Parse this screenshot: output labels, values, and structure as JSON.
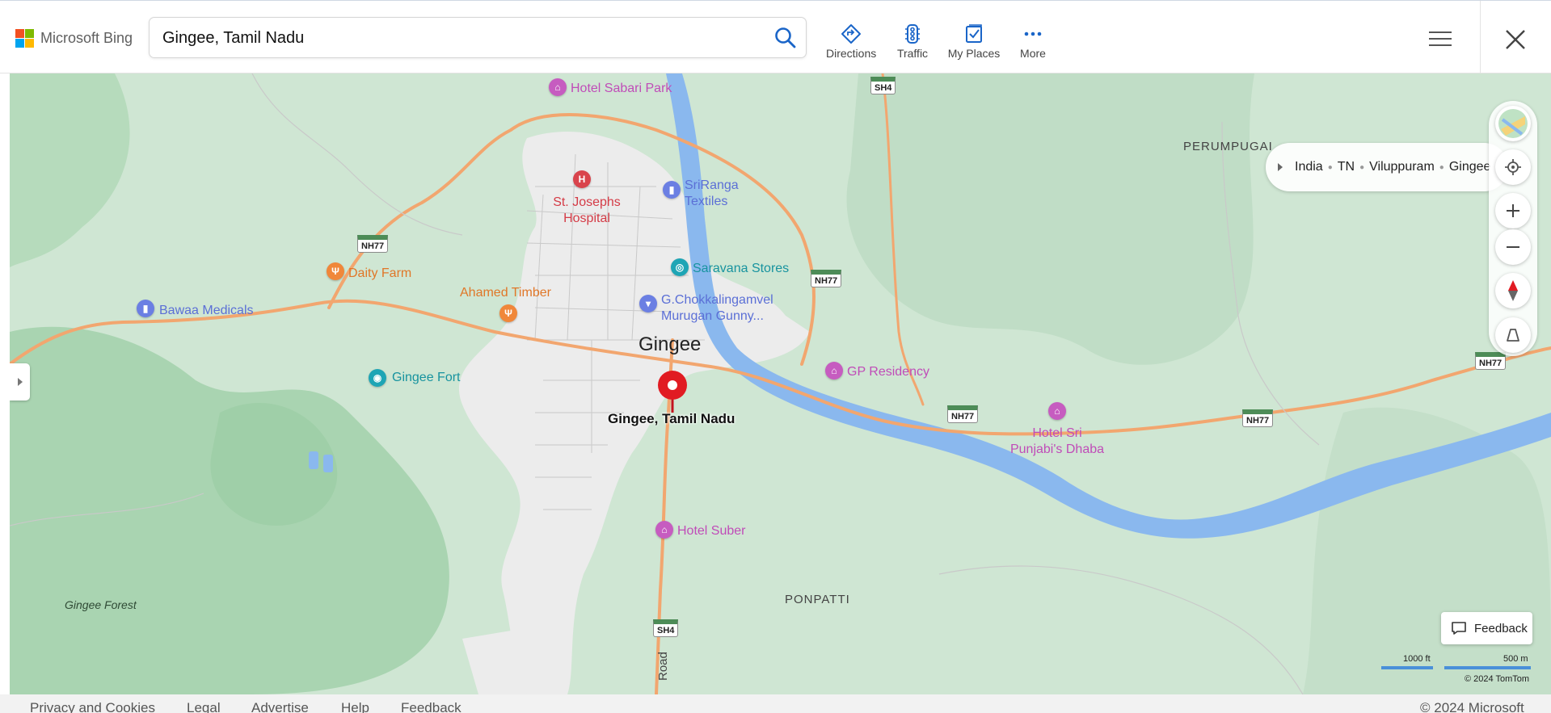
{
  "brand": {
    "name": "Microsoft Bing",
    "logo_colors": [
      "#f25022",
      "#7fba00",
      "#00a4ef",
      "#ffb900"
    ]
  },
  "search": {
    "value": "Gingee, Tamil Nadu",
    "icon": "search-icon"
  },
  "toolbar": [
    {
      "label": "Directions",
      "icon": "directions-icon"
    },
    {
      "label": "Traffic",
      "icon": "traffic-icon"
    },
    {
      "label": "My Places",
      "icon": "my-places-icon"
    },
    {
      "label": "More",
      "icon": "more-icon"
    }
  ],
  "breadcrumb": [
    "India",
    "TN",
    "Viluppuram",
    "Gingee"
  ],
  "map": {
    "pin_label": "Gingee, Tamil Nadu",
    "town_label": "Gingee",
    "place_labels": {
      "perumpugai": "PERUMPUGAI",
      "ponpatti": "PONPATTI",
      "forest": "Gingee Forest",
      "road": "Road"
    },
    "pois": [
      {
        "label": "Hotel Sabari Park",
        "icon": "hotel-icon"
      },
      {
        "label": "St. Josephs Hospital",
        "icon": "hospital-icon"
      },
      {
        "label": "SriRanga Textiles",
        "icon": "shopping-icon"
      },
      {
        "label": "Saravana Stores",
        "icon": "store-icon"
      },
      {
        "label": "Daity Farm",
        "icon": "restaurant-icon"
      },
      {
        "label": "Ahamed Timber",
        "icon": "restaurant-icon"
      },
      {
        "label": "G.Chokkalingamvel Murugan Gunny...",
        "icon": "cart-icon"
      },
      {
        "label": "Bawaa Medicals",
        "icon": "pharmacy-icon"
      },
      {
        "label": "Gingee Fort",
        "icon": "camera-icon"
      },
      {
        "label": "GP Residency",
        "icon": "hotel-icon"
      },
      {
        "label": "Hotel Sri Punjabi's Dhaba",
        "icon": "hotel-icon"
      },
      {
        "label": "Hotel Suber",
        "icon": "hotel-icon"
      }
    ],
    "road_shields": [
      "SH4",
      "NH77",
      "NH77",
      "NH77",
      "NH77",
      "NH77",
      "SH4"
    ],
    "scale": {
      "imperial": "1000 ft",
      "metric": "500 m"
    },
    "copyright": "© 2024 TomTom"
  },
  "feedback": {
    "label": "Feedback"
  },
  "footer": {
    "links": [
      "Privacy and Cookies",
      "Legal",
      "Advertise",
      "Help",
      "Feedback"
    ],
    "copyright": "© 2024 Microsoft"
  },
  "colors": {
    "accent": "#0067b8",
    "hotel": "#c65cc0",
    "hospital": "#d9444c",
    "food": "#f0873a",
    "shop": "#6b7fe3",
    "teal": "#1ea5b5",
    "water": "#8ab8ee",
    "road": "#f4a26a"
  }
}
